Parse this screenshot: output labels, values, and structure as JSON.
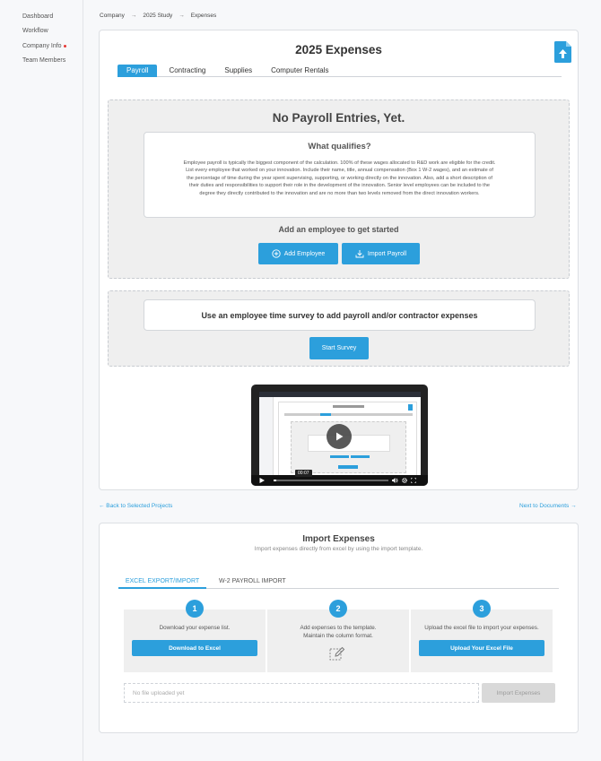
{
  "sidebar": {
    "items": [
      {
        "label": "Dashboard"
      },
      {
        "label": "Workflow"
      },
      {
        "label": "Company Info",
        "alert": true
      },
      {
        "label": "Team Members"
      }
    ]
  },
  "breadcrumb": [
    "Company",
    "2025 Study",
    "Expenses"
  ],
  "breadcrumb_separator": "→",
  "main": {
    "title": "2025 Expenses",
    "tabs": [
      {
        "label": "Payroll",
        "active": true
      },
      {
        "label": "Contracting"
      },
      {
        "label": "Supplies"
      },
      {
        "label": "Computer Rentals"
      }
    ]
  },
  "payroll_panel": {
    "title": "No Payroll Entries, Yet.",
    "qualifies_title": "What qualifies?",
    "qualifies_text": "Employee payroll is typically the biggest component of the calculation. 100% of these wages allocated to R&D work are eligible for the credit. List every employee that worked on your innovation. Include their name, title, annual compensation (Box 1 W-2 wages), and an estimate of the percentage of time during the year spent supervising, supporting, or working directly on the innovation. Also, add a short description of their duties and responsibilities to support their role in the development of the innovation. Senior level employees can be included to the degree they directly contributed to the innovation and are no more than two levels removed from the direct innovation workers.",
    "cta_text": "Add an employee to get started",
    "add_employee_label": "Add Employee",
    "import_payroll_label": "Import Payroll"
  },
  "survey_panel": {
    "text": "Use an employee time survey to add payroll and/or contractor expenses",
    "button_label": "Start Survey"
  },
  "video": {
    "time": "00:07",
    "progress": 0.02
  },
  "nav": {
    "back_label": "← Back to Selected Projects",
    "next_label": "Next to Documents →"
  },
  "import": {
    "title": "Import Expenses",
    "subtitle": "Import expenses directly from excel by using the import template.",
    "tabs": [
      {
        "label": "EXCEL EXPORT/IMPORT",
        "active": true
      },
      {
        "label": "W-2 PAYROLL IMPORT"
      }
    ],
    "steps": [
      {
        "num": "1",
        "text": "Download your expense list.",
        "button": "Download to Excel"
      },
      {
        "num": "2",
        "text_line1": "Add expenses to the template.",
        "text_line2": "Maintain the column format."
      },
      {
        "num": "3",
        "text": "Upload the excel file to import your expenses.",
        "button": "Upload Your Excel File"
      }
    ],
    "file_placeholder": "No file uploaded yet",
    "import_button": "Import Expenses"
  },
  "colors": {
    "accent": "#2c9fdc",
    "alert": "#e53935"
  }
}
